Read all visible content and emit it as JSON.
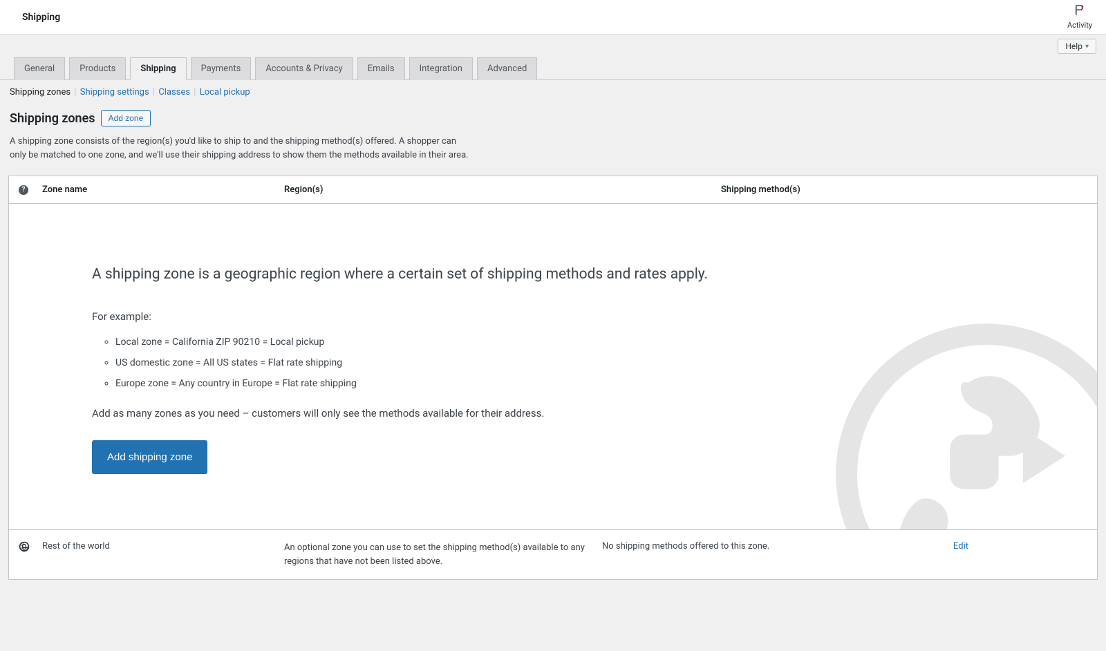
{
  "header": {
    "title": "Shipping",
    "activity_label": "Activity"
  },
  "help": {
    "label": "Help"
  },
  "tabs": [
    {
      "label": "General"
    },
    {
      "label": "Products"
    },
    {
      "label": "Shipping",
      "active": true
    },
    {
      "label": "Payments"
    },
    {
      "label": "Accounts & Privacy"
    },
    {
      "label": "Emails"
    },
    {
      "label": "Integration"
    },
    {
      "label": "Advanced"
    }
  ],
  "subnav": {
    "current": "Shipping zones",
    "links": [
      "Shipping settings",
      "Classes",
      "Local pickup"
    ]
  },
  "heading": {
    "title": "Shipping zones",
    "add_zone_btn": "Add zone"
  },
  "description": "A shipping zone consists of the region(s) you'd like to ship to and the shipping method(s) offered. A shopper can only be matched to one zone, and we'll use their shipping address to show them the methods available in their area.",
  "columns": {
    "name": "Zone name",
    "regions": "Region(s)",
    "methods": "Shipping method(s)"
  },
  "empty_state": {
    "heading": "A shipping zone is a geographic region where a certain set of shipping methods and rates apply.",
    "for_example": "For example:",
    "examples": [
      "Local zone = California ZIP 90210 = Local pickup",
      "US domestic zone = All US states = Flat rate shipping",
      "Europe zone = Any country in Europe = Flat rate shipping"
    ],
    "note": "Add as many zones as you need – customers will only see the methods available for their address.",
    "button": "Add shipping zone"
  },
  "footer_row": {
    "zone_name": "Rest of the world",
    "regions": "An optional zone you can use to set the shipping method(s) available to any regions that have not been listed above.",
    "methods": "No shipping methods offered to this zone.",
    "edit": "Edit"
  }
}
